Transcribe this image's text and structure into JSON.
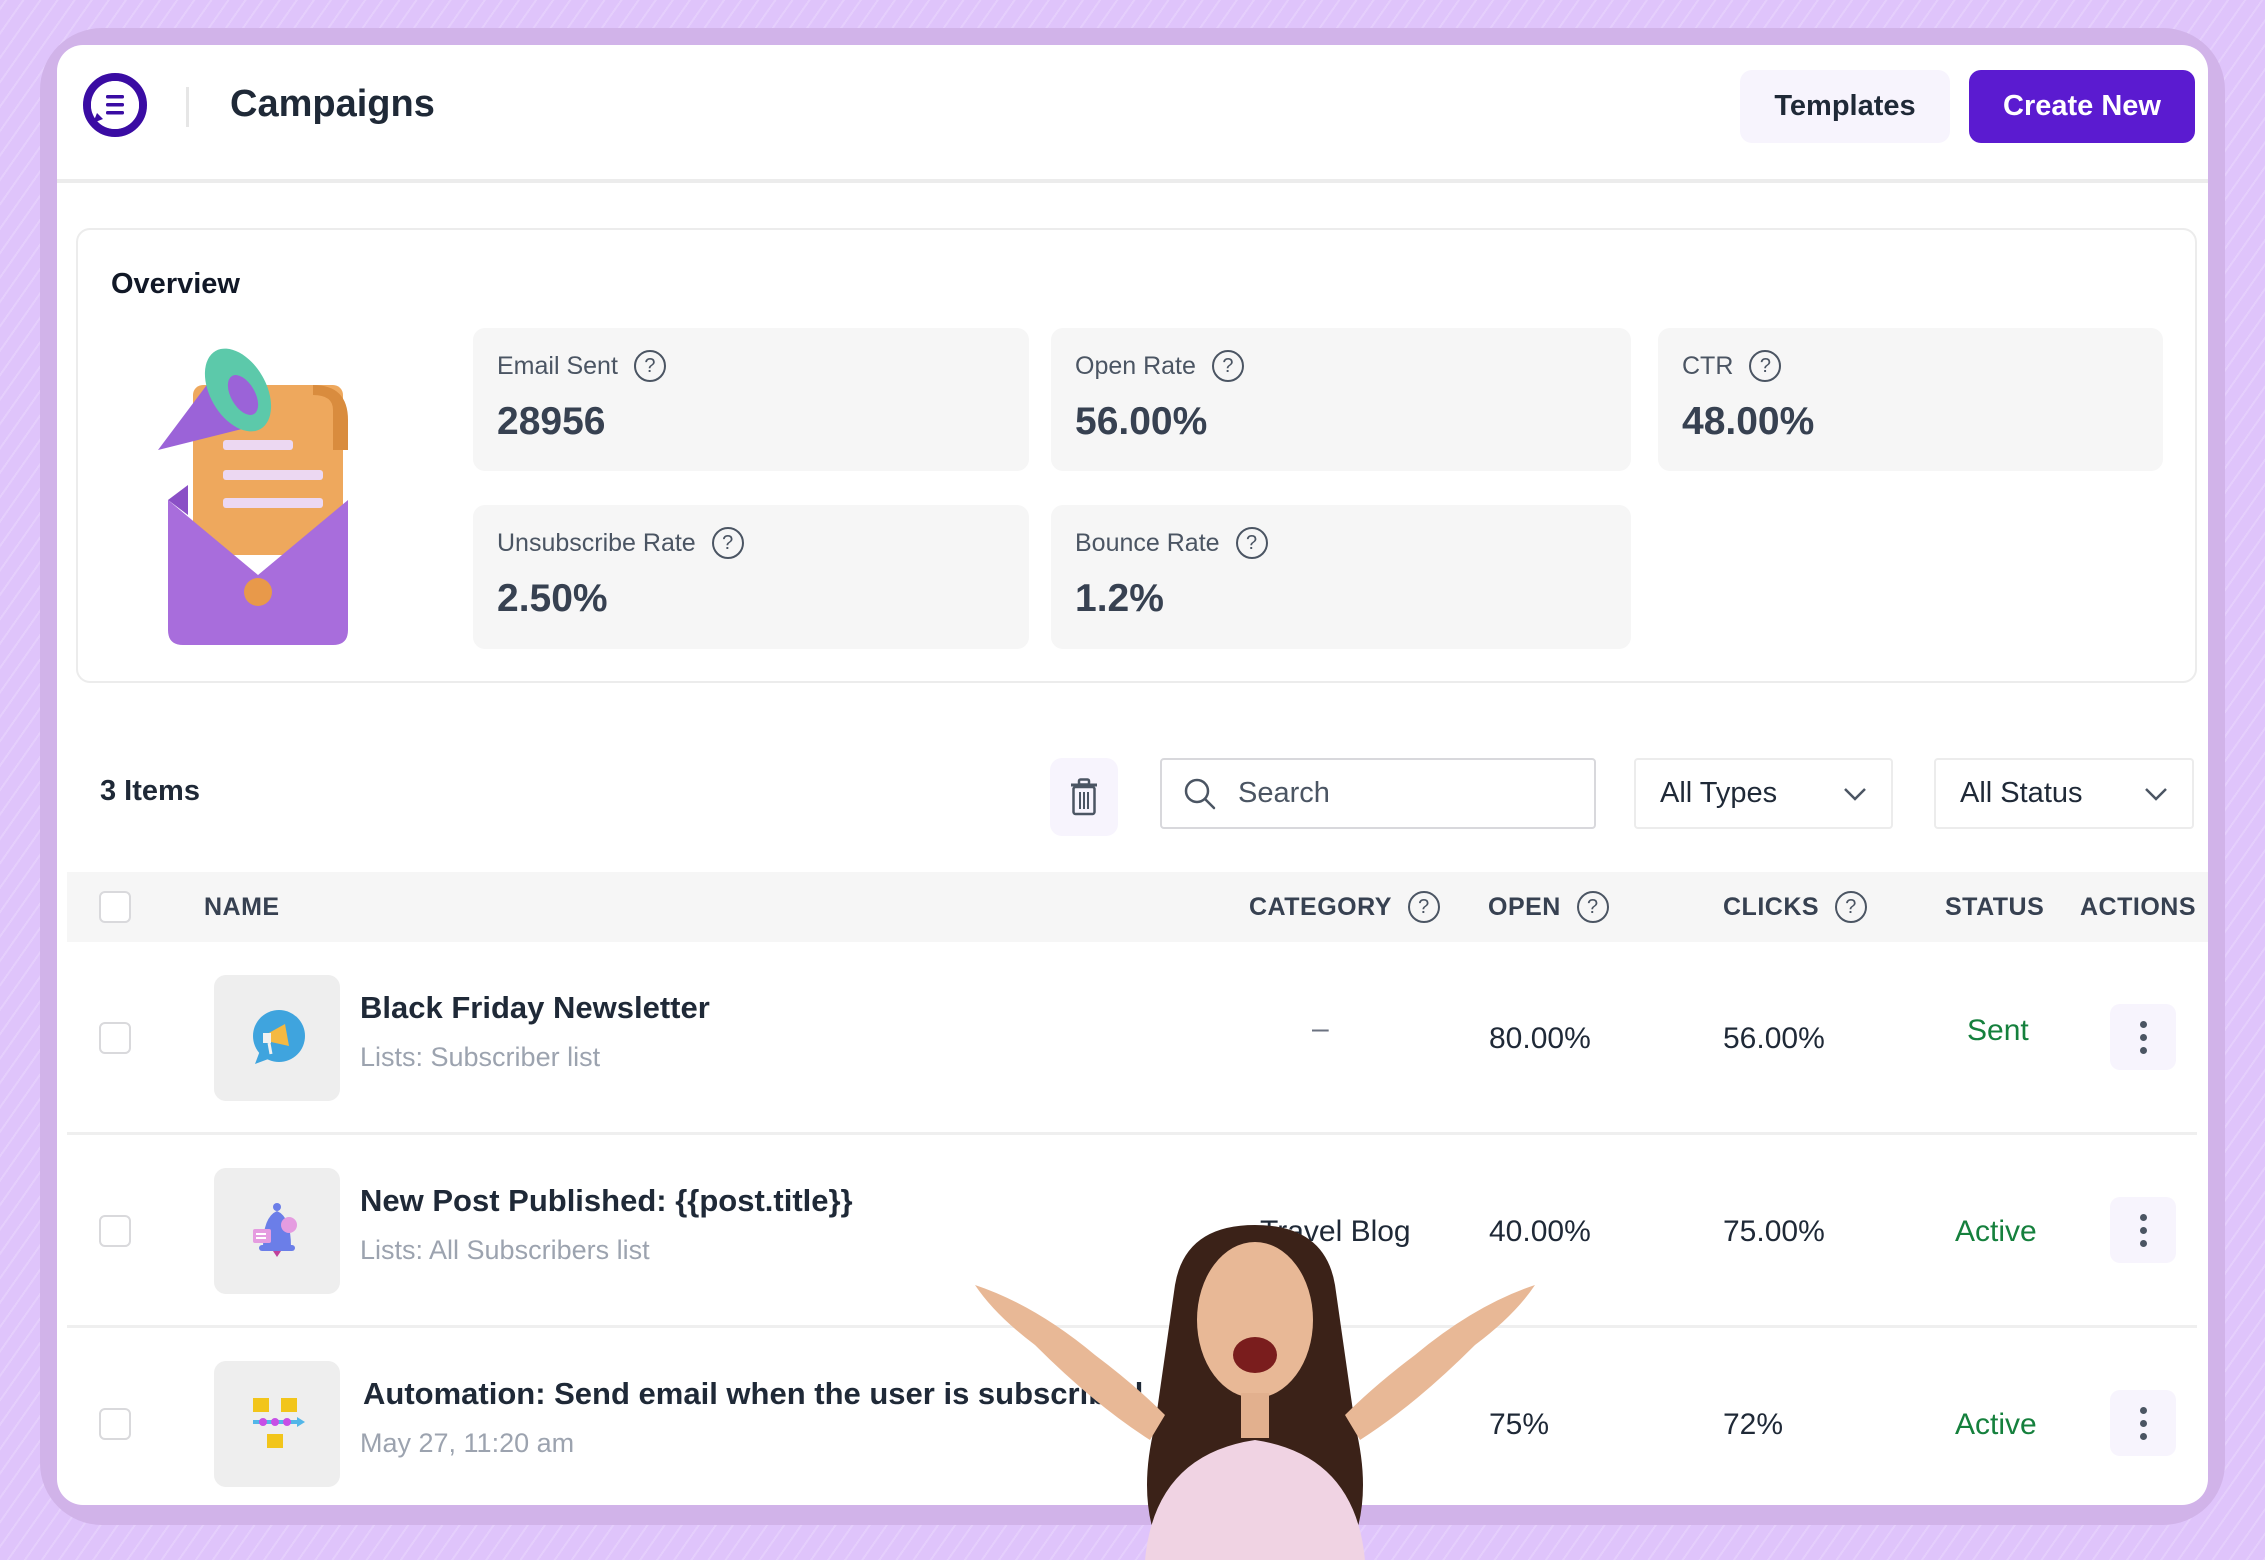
{
  "header": {
    "title": "Campaigns",
    "templates_label": "Templates",
    "create_label": "Create New",
    "brand_color": "#5b1bd0"
  },
  "overview": {
    "title": "Overview",
    "stats": [
      {
        "label": "Email Sent",
        "value": "28956"
      },
      {
        "label": "Open Rate",
        "value": "56.00%"
      },
      {
        "label": "CTR",
        "value": "48.00%"
      },
      {
        "label": "Unsubscribe Rate",
        "value": "2.50%"
      },
      {
        "label": "Bounce Rate",
        "value": "1.2%"
      }
    ]
  },
  "toolbar": {
    "items_count": "3 Items",
    "search_placeholder": "Search",
    "search_value": "",
    "type_filter": "All Types",
    "status_filter": "All Status"
  },
  "table": {
    "columns": {
      "name": "NAME",
      "category": "CATEGORY",
      "open": "OPEN",
      "clicks": "CLICKS",
      "status": "STATUS",
      "actions": "ACTIONS"
    },
    "rows": [
      {
        "name": "Black Friday Newsletter",
        "sub": "Lists: Subscriber list",
        "category": "–",
        "open": "80.00%",
        "clicks": "56.00%",
        "status": "Sent",
        "icon": "megaphone-chat-icon"
      },
      {
        "name": "New Post Published: {{post.title}}",
        "sub": "Lists: All Subscribers list",
        "category": "Travel Blog",
        "open": "40.00%",
        "clicks": "75.00%",
        "status": "Active",
        "icon": "bell-icon"
      },
      {
        "name": "Automation: Send email when the user is subscribed",
        "sub": "May 27, 11:20 am",
        "category": "",
        "open": "75%",
        "clicks": "72%",
        "status": "Active",
        "icon": "workflow-icon"
      }
    ],
    "status_color": "#15803d"
  }
}
